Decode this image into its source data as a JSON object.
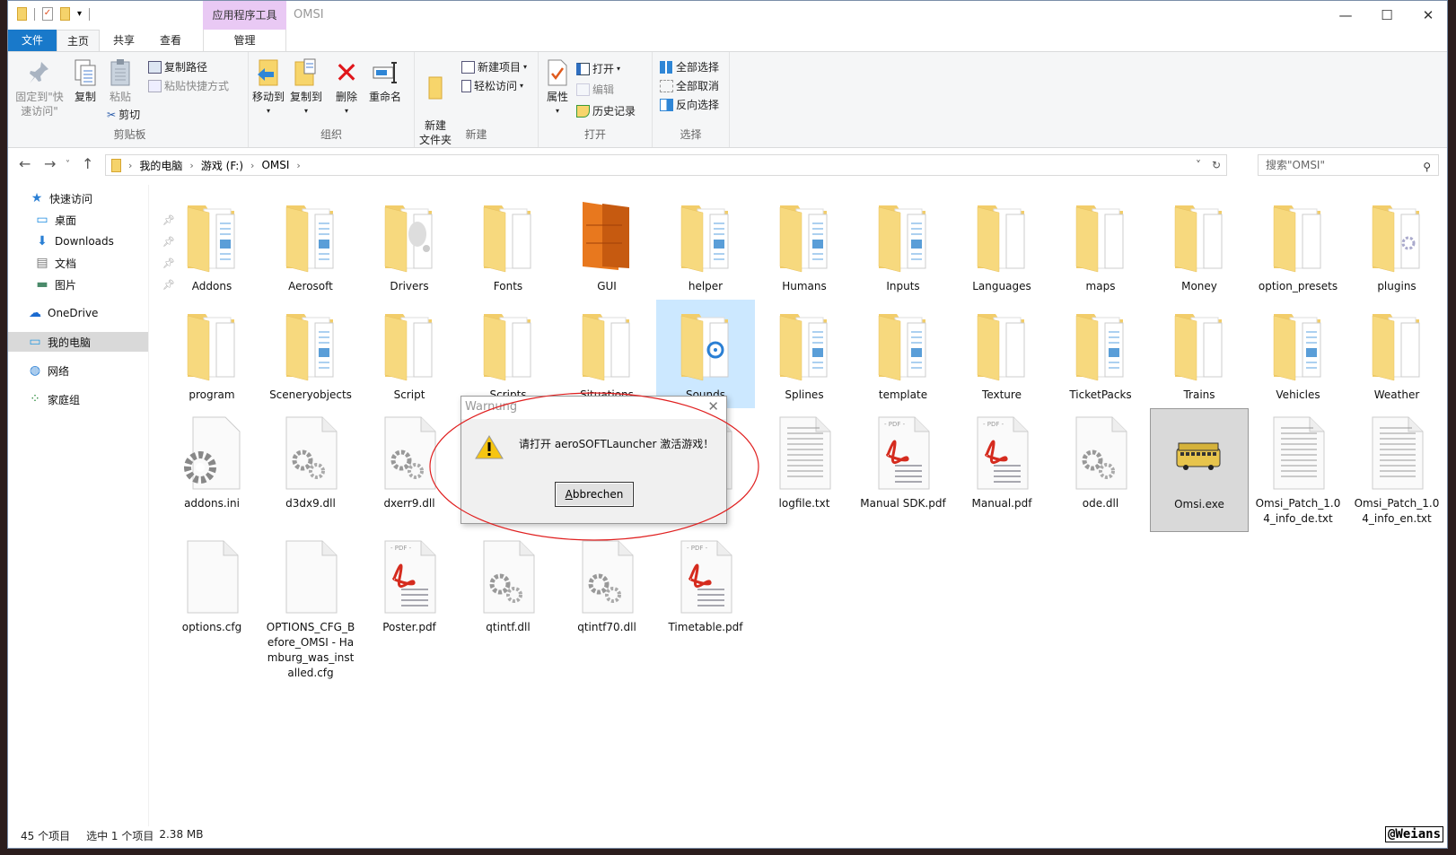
{
  "window": {
    "title": "OMSI",
    "context_tab_group": "应用程序工具",
    "controls": {
      "minimize": "—",
      "maximize": "☐",
      "close": "✕"
    }
  },
  "tabs": [
    {
      "label": "文件"
    },
    {
      "label": "主页"
    },
    {
      "label": "共享"
    },
    {
      "label": "查看"
    },
    {
      "label": "管理"
    }
  ],
  "ribbon": {
    "clipboard": {
      "label": "剪贴板",
      "pin": "固定到\"快速访问\"",
      "copy": "复制",
      "paste": "粘贴",
      "copy_path": "复制路径",
      "paste_shortcut": "粘贴快捷方式",
      "cut": "剪切"
    },
    "organize": {
      "label": "组织",
      "move_to": "移动到",
      "copy_to": "复制到",
      "delete": "删除",
      "rename": "重命名"
    },
    "new": {
      "label": "新建",
      "new_folder": "新建\n文件夹",
      "new_item": "新建项目",
      "easy_access": "轻松访问"
    },
    "open": {
      "label": "打开",
      "properties": "属性",
      "open": "打开",
      "edit": "编辑",
      "history": "历史记录"
    },
    "select": {
      "label": "选择",
      "select_all": "全部选择",
      "select_none": "全部取消",
      "invert": "反向选择"
    }
  },
  "address": {
    "crumbs": [
      "我的电脑",
      "游戏 (F:)",
      "OMSI"
    ],
    "search_placeholder": "搜索\"OMSI\""
  },
  "nav": [
    {
      "label": "快速访问",
      "icon": "star-icon"
    },
    {
      "label": "桌面",
      "icon": "desktop-icon",
      "pinned": true
    },
    {
      "label": "Downloads",
      "icon": "download-icon",
      "pinned": true
    },
    {
      "label": "文档",
      "icon": "document-icon",
      "pinned": true
    },
    {
      "label": "图片",
      "icon": "picture-icon",
      "pinned": true
    },
    {
      "label": "OneDrive",
      "icon": "cloud-icon"
    },
    {
      "label": "我的电脑",
      "icon": "computer-icon",
      "selected": true
    },
    {
      "label": "网络",
      "icon": "network-icon"
    },
    {
      "label": "家庭组",
      "icon": "homegroup-icon"
    }
  ],
  "files": [
    {
      "name": "Addons",
      "type": "folder"
    },
    {
      "name": "Aerosoft",
      "type": "folder"
    },
    {
      "name": "Drivers",
      "type": "folder-drivers"
    },
    {
      "name": "Fonts",
      "type": "folder-empty"
    },
    {
      "name": "GUI",
      "type": "folder-gui"
    },
    {
      "name": "helper",
      "type": "folder"
    },
    {
      "name": "Humans",
      "type": "folder"
    },
    {
      "name": "Inputs",
      "type": "folder"
    },
    {
      "name": "Languages",
      "type": "folder-empty"
    },
    {
      "name": "maps",
      "type": "folder-empty"
    },
    {
      "name": "Money",
      "type": "folder-empty"
    },
    {
      "name": "option_presets",
      "type": "folder-empty"
    },
    {
      "name": "plugins",
      "type": "folder-gear"
    },
    {
      "name": "program",
      "type": "folder-empty"
    },
    {
      "name": "Sceneryobjects",
      "type": "folder"
    },
    {
      "name": "Script",
      "type": "folder-empty"
    },
    {
      "name": "Scripts",
      "type": "folder-empty"
    },
    {
      "name": "Situations",
      "type": "folder-empty"
    },
    {
      "name": "Sounds",
      "type": "folder-sounds",
      "selected": true
    },
    {
      "name": "Splines",
      "type": "folder"
    },
    {
      "name": "template",
      "type": "folder"
    },
    {
      "name": "Texture",
      "type": "folder-empty"
    },
    {
      "name": "TicketPacks",
      "type": "folder"
    },
    {
      "name": "Trains",
      "type": "folder-empty"
    },
    {
      "name": "Vehicles",
      "type": "folder"
    },
    {
      "name": "Weather",
      "type": "folder-empty"
    },
    {
      "name": "addons.ini",
      "type": "ini"
    },
    {
      "name": "d3dx9.dll",
      "type": "dll"
    },
    {
      "name": "dxerr9.dll",
      "type": "dll"
    },
    {
      "name": "",
      "type": "blank"
    },
    {
      "name": "",
      "type": "blank"
    },
    {
      "name": "",
      "type": "blank"
    },
    {
      "name": "logfile.txt",
      "type": "txt"
    },
    {
      "name": "Manual SDK.pdf",
      "type": "pdf"
    },
    {
      "name": "Manual.pdf",
      "type": "pdf"
    },
    {
      "name": "ode.dll",
      "type": "dll"
    },
    {
      "name": "Omsi.exe",
      "type": "exe",
      "focused": true
    },
    {
      "name": "Omsi_Patch_1.04_info_de.txt",
      "type": "txt"
    },
    {
      "name": "Omsi_Patch_1.04_info_en.txt",
      "type": "txt"
    },
    {
      "name": "options.cfg",
      "type": "blank"
    },
    {
      "name": "OPTIONS_CFG_Before_OMSI - Hamburg_was_installed.cfg",
      "type": "blank"
    },
    {
      "name": "Poster.pdf",
      "type": "pdf"
    },
    {
      "name": "qtintf.dll",
      "type": "dll"
    },
    {
      "name": "qtintf70.dll",
      "type": "dll"
    },
    {
      "name": "Timetable.pdf",
      "type": "pdf"
    }
  ],
  "status": {
    "count": "45 个项目",
    "selection": "选中 1 个项目",
    "size": "2.38 MB"
  },
  "dialog": {
    "title": "Warnung",
    "message": "请打开 aeroSOFTLauncher 激活游戏！",
    "button_accel": "A",
    "button_rest": "bbrechen"
  },
  "watermark": "@Weians",
  "colors": {
    "accent": "#1979ca",
    "context_tab": "#e9c9f4",
    "selection": "#cce8ff",
    "annotation": "#e02020"
  }
}
